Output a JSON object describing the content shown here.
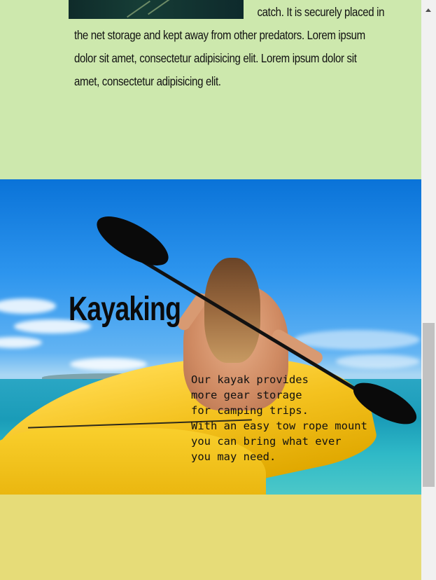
{
  "top_section": {
    "lines": [
      "catch. It is securely placed in",
      "the net storage and kept away from other predators. Lorem ipsum",
      "dolor sit amet, consectetur adipisicing elit. Lorem ipsum dolor sit",
      "amet, consectetur adipisicing elit."
    ]
  },
  "kayak_section": {
    "title": "Kayaking",
    "description_lines": [
      "Our kayak provides",
      "more gear storage",
      "for camping trips.",
      "With an easy tow rope mount",
      "you can bring what ever",
      "you may need."
    ]
  },
  "colors": {
    "top_bg": "#cde8ad",
    "bottom_bg": "#e6dc78",
    "scrollbar_thumb": "#c1c1c1"
  },
  "icons": {
    "scroll_up": "scroll-up-arrow-icon"
  }
}
